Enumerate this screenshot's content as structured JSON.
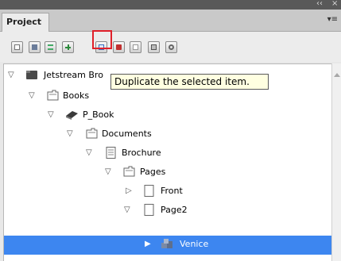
{
  "window": {
    "panel_title": "Project",
    "collapse_glyph": "‹‹",
    "close_glyph": "×",
    "menu_glyph": "▾≡"
  },
  "toolbar": {
    "buttons": [
      {
        "icon": "new-document-icon"
      },
      {
        "icon": "save-icon"
      },
      {
        "icon": "properties-icon"
      },
      {
        "icon": "add-icon"
      },
      {
        "icon": "duplicate-icon"
      },
      {
        "icon": "delete-icon"
      },
      {
        "icon": "blank-page-icon"
      },
      {
        "icon": "preview-icon"
      },
      {
        "icon": "settings-icon"
      }
    ],
    "highlighted": "duplicate-icon",
    "highlight_color": "#e0202a"
  },
  "tooltip": {
    "text": "Duplicate the selected item."
  },
  "tree": {
    "items": [
      {
        "label": "Jetstream Bro",
        "icon": "root-folder-icon",
        "expanded": true
      },
      {
        "label": "Books",
        "icon": "folder-icon",
        "expanded": true
      },
      {
        "label": "P_Book",
        "icon": "book-icon",
        "expanded": true
      },
      {
        "label": "Documents",
        "icon": "folder-icon",
        "expanded": true
      },
      {
        "label": "Brochure",
        "icon": "document-icon",
        "expanded": true
      },
      {
        "label": "Pages",
        "icon": "folder-icon",
        "expanded": true
      },
      {
        "label": "Front",
        "icon": "page-icon",
        "expanded": false
      },
      {
        "label": "Page2",
        "icon": "page-icon",
        "expanded": true
      },
      {
        "label": "Venice",
        "icon": "image-group-icon",
        "expanded": false,
        "selected": true
      }
    ],
    "selection_color": "#3d86f0"
  }
}
